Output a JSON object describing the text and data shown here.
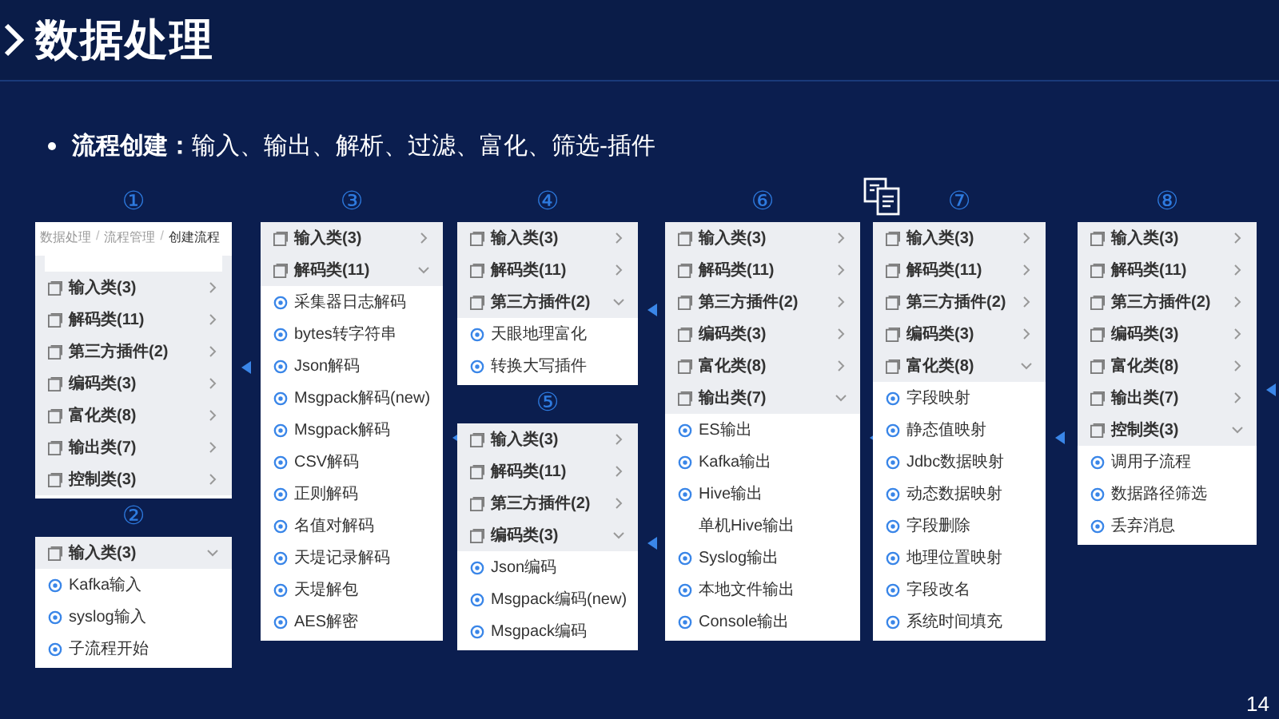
{
  "title": "数据处理",
  "bullet": "**流程创建：**输入、输出、解析、过滤、富化、筛选-插件",
  "columns": [
    {
      "panels": [
        {
          "number": "①",
          "breadcrumb": {
            "separator": "/",
            "items": [
              "数据处理",
              "流程管理",
              "创建流程"
            ]
          },
          "handle": true,
          "categories": [
            {
              "label": "输入类(3)",
              "expanded": false
            },
            {
              "label": "解码类(11)",
              "expanded": false
            },
            {
              "label": "第三方插件(2)",
              "expanded": false
            },
            {
              "label": "编码类(3)",
              "expanded": false
            },
            {
              "label": "富化类(8)",
              "expanded": false
            },
            {
              "label": "输出类(7)",
              "expanded": false
            },
            {
              "label": "控制类(3)",
              "expanded": false
            }
          ]
        },
        {
          "number": "②",
          "handle": false,
          "categories": [
            {
              "label": "输入类(3)",
              "expanded": true
            }
          ],
          "items": [
            {
              "label": "Kafka输入",
              "icon": true
            },
            {
              "label": "syslog输入",
              "icon": true
            },
            {
              "label": "子流程开始",
              "icon": true
            }
          ]
        }
      ]
    },
    {
      "panels": [
        {
          "number": "③",
          "handle": true,
          "categories": [
            {
              "label": "输入类(3)",
              "expanded": false
            },
            {
              "label": "解码类(11)",
              "expanded": true
            }
          ],
          "items": [
            {
              "label": "采集器日志解码",
              "icon": true
            },
            {
              "label": "bytes转字符串",
              "icon": true
            },
            {
              "label": "Json解码",
              "icon": true
            },
            {
              "label": "Msgpack解码(new)",
              "icon": true
            },
            {
              "label": "Msgpack解码",
              "icon": true
            },
            {
              "label": "CSV解码",
              "icon": true
            },
            {
              "label": "正则解码",
              "icon": true
            },
            {
              "label": "名值对解码",
              "icon": true
            },
            {
              "label": "天堤记录解码",
              "icon": true
            },
            {
              "label": "天堤解包",
              "icon": true
            },
            {
              "label": "AES解密",
              "icon": true
            }
          ]
        }
      ]
    },
    {
      "panels": [
        {
          "number": "④",
          "handle": true,
          "categories": [
            {
              "label": "输入类(3)",
              "expanded": false
            },
            {
              "label": "解码类(11)",
              "expanded": false
            },
            {
              "label": "第三方插件(2)",
              "expanded": true
            }
          ],
          "items": [
            {
              "label": "天眼地理富化",
              "icon": true
            },
            {
              "label": "转换大写插件",
              "icon": true
            }
          ]
        },
        {
          "number": "⑤",
          "handle": true,
          "categories": [
            {
              "label": "输入类(3)",
              "expanded": false
            },
            {
              "label": "解码类(11)",
              "expanded": false
            },
            {
              "label": "第三方插件(2)",
              "expanded": false
            },
            {
              "label": "编码类(3)",
              "expanded": true
            }
          ],
          "items": [
            {
              "label": "Json编码",
              "icon": true
            },
            {
              "label": "Msgpack编码(new)",
              "icon": true
            },
            {
              "label": "Msgpack编码",
              "icon": true
            }
          ]
        }
      ]
    },
    {
      "panels": [
        {
          "number": "⑥",
          "handle": true,
          "categories": [
            {
              "label": "输入类(3)",
              "expanded": false
            },
            {
              "label": "解码类(11)",
              "expanded": false
            },
            {
              "label": "第三方插件(2)",
              "expanded": false
            },
            {
              "label": "编码类(3)",
              "expanded": false
            },
            {
              "label": "富化类(8)",
              "expanded": false
            },
            {
              "label": "输出类(7)",
              "expanded": true
            }
          ],
          "items": [
            {
              "label": "ES输出",
              "icon": true
            },
            {
              "label": "Kafka输出",
              "icon": true
            },
            {
              "label": "Hive输出",
              "icon": true
            },
            {
              "label": "单机Hive输出",
              "icon": false
            },
            {
              "label": "Syslog输出",
              "icon": true
            },
            {
              "label": "本地文件输出",
              "icon": true
            },
            {
              "label": "Console输出",
              "icon": true
            }
          ]
        }
      ]
    },
    {
      "panels": [
        {
          "number": "⑦",
          "handle": true,
          "categories": [
            {
              "label": "输入类(3)",
              "expanded": false
            },
            {
              "label": "解码类(11)",
              "expanded": false
            },
            {
              "label": "第三方插件(2)",
              "expanded": false
            },
            {
              "label": "编码类(3)",
              "expanded": false
            },
            {
              "label": "富化类(8)",
              "expanded": true
            }
          ],
          "items": [
            {
              "label": "字段映射",
              "icon": true
            },
            {
              "label": "静态值映射",
              "icon": true
            },
            {
              "label": "Jdbc数据映射",
              "icon": true
            },
            {
              "label": "动态数据映射",
              "icon": true
            },
            {
              "label": "字段删除",
              "icon": true
            },
            {
              "label": "地理位置映射",
              "icon": true
            },
            {
              "label": "字段改名",
              "icon": true
            },
            {
              "label": "系统时间填充",
              "icon": true
            }
          ]
        }
      ]
    },
    {
      "panels": [
        {
          "number": "⑧",
          "handle": true,
          "categories": [
            {
              "label": "输入类(3)",
              "expanded": false
            },
            {
              "label": "解码类(11)",
              "expanded": false
            },
            {
              "label": "第三方插件(2)",
              "expanded": false
            },
            {
              "label": "编码类(3)",
              "expanded": false
            },
            {
              "label": "富化类(8)",
              "expanded": false
            },
            {
              "label": "输出类(7)",
              "expanded": false
            },
            {
              "label": "控制类(3)",
              "expanded": true
            }
          ],
          "items": [
            {
              "label": "调用子流程",
              "icon": true
            },
            {
              "label": "数据路径筛选",
              "icon": true
            },
            {
              "label": "丢弃消息",
              "icon": true
            }
          ]
        }
      ]
    }
  ],
  "page_number": "14"
}
